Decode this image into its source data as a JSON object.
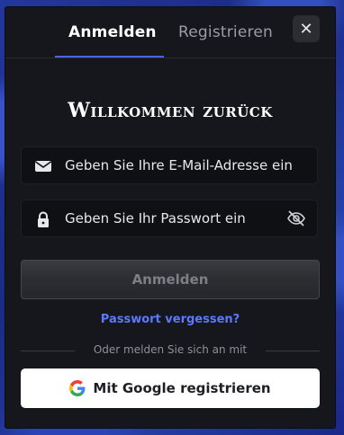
{
  "tabs": {
    "login_label": "Anmelden",
    "register_label": "Registrieren"
  },
  "close_label": "✕",
  "heading": "Willkommen zurück",
  "form": {
    "email_placeholder": "Geben Sie Ihre E-Mail-Adresse ein",
    "email_value": "",
    "password_placeholder": "Geben Sie Ihr Passwort ein",
    "password_value": "",
    "submit_label": "Anmelden"
  },
  "forgot_password_label": "Passwort vergessen?",
  "divider_label": "Oder melden Sie sich an mit",
  "google_button_label": "Mit Google registrieren",
  "icons": [
    "envelope-icon",
    "lock-icon",
    "eye-off-icon",
    "google-logo-icon",
    "close-icon"
  ],
  "colors": {
    "accent": "#4a64e6",
    "link": "#5b78ff",
    "background": "#16171c",
    "frame": "#1b2d8c"
  }
}
